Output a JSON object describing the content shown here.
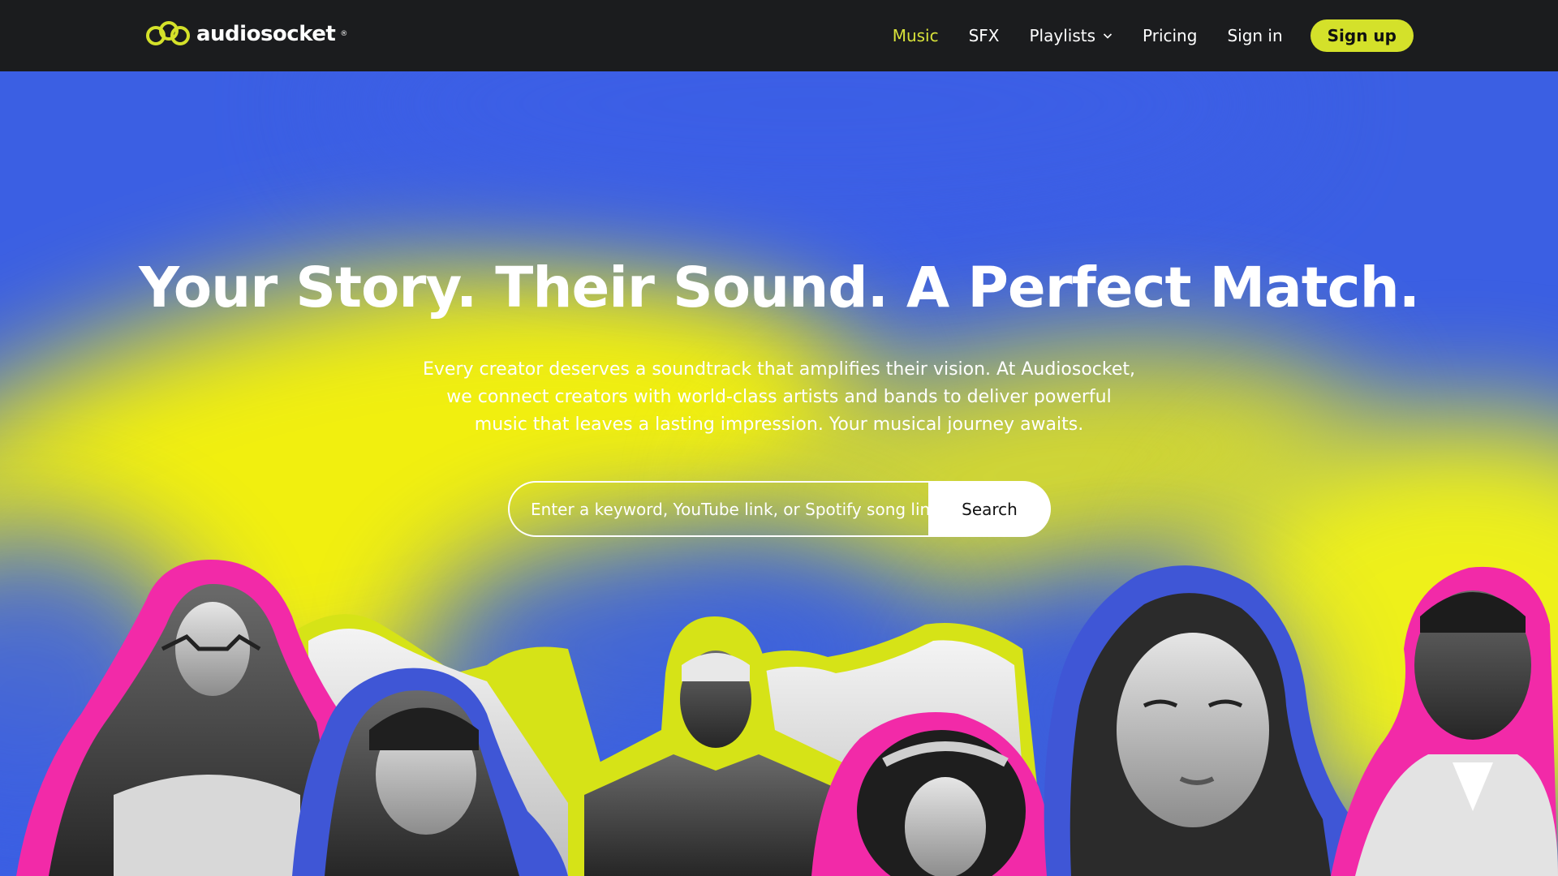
{
  "brand": {
    "name": "audiosocket",
    "tm": "®"
  },
  "nav": {
    "items": [
      {
        "label": "Music",
        "active": true
      },
      {
        "label": "SFX",
        "active": false
      },
      {
        "label": "Playlists",
        "active": false,
        "has_dropdown": true
      },
      {
        "label": "Pricing",
        "active": false
      },
      {
        "label": "Sign in",
        "active": false
      }
    ],
    "signup_label": "Sign up"
  },
  "hero": {
    "title": "Your Story. Their Sound. A Perfect Match.",
    "description": "Every creator deserves a soundtrack that amplifies their vision. At Audiosocket, we connect creators with world-class artists and bands to deliver powerful music that leaves a lasting impression. Your musical journey awaits."
  },
  "search": {
    "placeholder": "Enter a keyword, YouTube link, or Spotify song link...",
    "button_label": "Search"
  },
  "colors": {
    "header_bg": "#1b1c1e",
    "accent": "#d4e12a",
    "active_nav": "#d8e23a",
    "hero_blue": "#3b5fe3",
    "hero_yellow": "#f1ef0f",
    "outline_pink": "#f22aa8",
    "outline_blue": "#3f56d6",
    "outline_lime": "#d6e317"
  },
  "icons": {
    "logo": "audiosocket-logo-icon",
    "playlists_dropdown": "chevron-down-icon"
  }
}
